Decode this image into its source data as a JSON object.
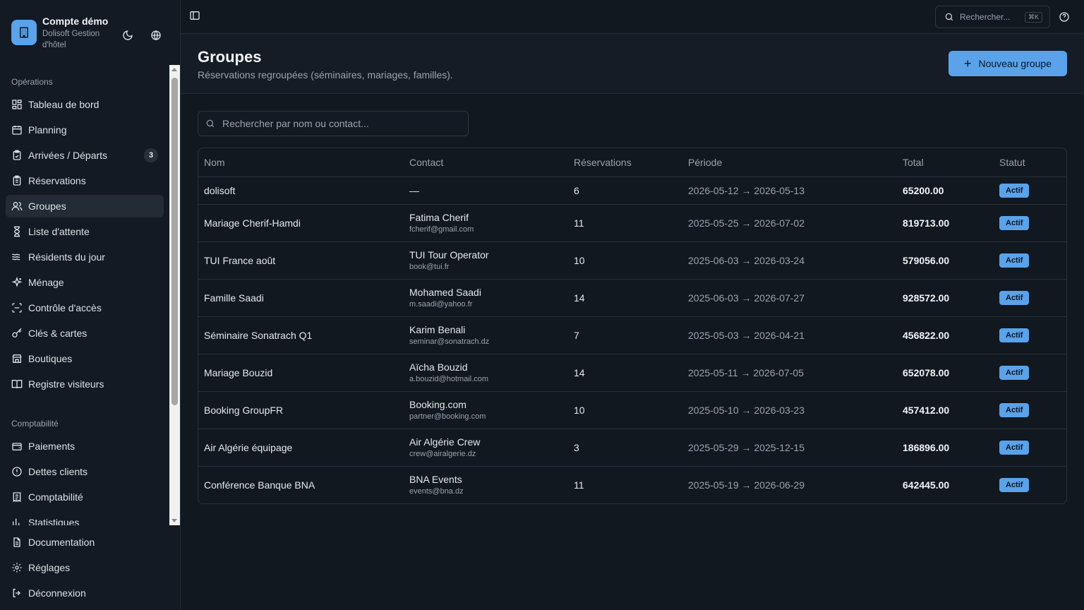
{
  "brand": {
    "title": "Compte démo",
    "subtitle": "Dolisoft Gestion d'hôtel"
  },
  "sidebar": {
    "sections": [
      {
        "label": "Opérations"
      },
      {
        "label": "Comptabilité"
      }
    ],
    "items": [
      {
        "label": "Tableau de bord",
        "icon": "dashboard-icon"
      },
      {
        "label": "Planning",
        "icon": "calendar-icon"
      },
      {
        "label": "Arrivées / Départs",
        "icon": "clipboard-check-icon",
        "badge": "3"
      },
      {
        "label": "Réservations",
        "icon": "clipboard-list-icon"
      },
      {
        "label": "Groupes",
        "icon": "users-icon",
        "active": true
      },
      {
        "label": "Liste d'attente",
        "icon": "hourglass-icon"
      },
      {
        "label": "Résidents du jour",
        "icon": "waves-icon"
      },
      {
        "label": "Ménage",
        "icon": "sparkles-icon"
      },
      {
        "label": "Contrôle d'accès",
        "icon": "scan-icon"
      },
      {
        "label": "Clés & cartes",
        "icon": "key-icon"
      },
      {
        "label": "Boutiques",
        "icon": "store-icon"
      },
      {
        "label": "Registre visiteurs",
        "icon": "book-open-icon"
      },
      {
        "label": "Paiements",
        "icon": "wallet-icon"
      },
      {
        "label": "Dettes clients",
        "icon": "alert-circle-icon"
      },
      {
        "label": "Comptabilité",
        "icon": "receipt-icon"
      },
      {
        "label": "Statistiques",
        "icon": "bar-chart-icon"
      }
    ],
    "footer": [
      {
        "label": "Documentation",
        "icon": "file-text-icon"
      },
      {
        "label": "Réglages",
        "icon": "settings-icon"
      },
      {
        "label": "Déconnexion",
        "icon": "logout-icon"
      }
    ]
  },
  "topbar": {
    "search_placeholder": "Rechercher...",
    "shortcut": "⌘K"
  },
  "header": {
    "title": "Groupes",
    "subtitle": "Réservations regroupées (séminaires, mariages, familles).",
    "new_button": "Nouveau groupe"
  },
  "search": {
    "placeholder": "Rechercher par nom ou contact..."
  },
  "table": {
    "columns": [
      "Nom",
      "Contact",
      "Réservations",
      "Période",
      "Total",
      "Statut"
    ],
    "rows": [
      {
        "name": "dolisoft",
        "contact": "—",
        "email": "",
        "reservations": "6",
        "period": "2026-05-12 → 2026-05-13",
        "total": "65200.00",
        "status": "Actif"
      },
      {
        "name": "Mariage Cherif-Hamdi",
        "contact": "Fatima Cherif",
        "email": "fcherif@gmail.com",
        "reservations": "11",
        "period": "2025-05-25 → 2026-07-02",
        "total": "819713.00",
        "status": "Actif"
      },
      {
        "name": "TUI France août",
        "contact": "TUI Tour Operator",
        "email": "book@tui.fr",
        "reservations": "10",
        "period": "2025-06-03 → 2026-03-24",
        "total": "579056.00",
        "status": "Actif"
      },
      {
        "name": "Famille Saadi",
        "contact": "Mohamed Saadi",
        "email": "m.saadi@yahoo.fr",
        "reservations": "14",
        "period": "2025-06-03 → 2026-07-27",
        "total": "928572.00",
        "status": "Actif"
      },
      {
        "name": "Séminaire Sonatrach Q1",
        "contact": "Karim Benali",
        "email": "seminar@sonatrach.dz",
        "reservations": "7",
        "period": "2025-05-03 → 2026-04-21",
        "total": "456822.00",
        "status": "Actif"
      },
      {
        "name": "Mariage Bouzid",
        "contact": "Aïcha Bouzid",
        "email": "a.bouzid@hotmail.com",
        "reservations": "14",
        "period": "2025-05-11 → 2026-07-05",
        "total": "652078.00",
        "status": "Actif"
      },
      {
        "name": "Booking GroupFR",
        "contact": "Booking.com",
        "email": "partner@booking.com",
        "reservations": "10",
        "period": "2025-05-10 → 2026-03-23",
        "total": "457412.00",
        "status": "Actif"
      },
      {
        "name": "Air Algérie équipage",
        "contact": "Air Algérie Crew",
        "email": "crew@airalgerie.dz",
        "reservations": "3",
        "period": "2025-05-29 → 2025-12-15",
        "total": "186896.00",
        "status": "Actif"
      },
      {
        "name": "Conférence Banque BNA",
        "contact": "BNA Events",
        "email": "events@bna.dz",
        "reservations": "11",
        "period": "2025-05-19 → 2026-06-29",
        "total": "642445.00",
        "status": "Actif"
      }
    ]
  },
  "colors": {
    "accent": "#5aa2ea",
    "background": "#111820",
    "sidebar": "#131a23"
  }
}
